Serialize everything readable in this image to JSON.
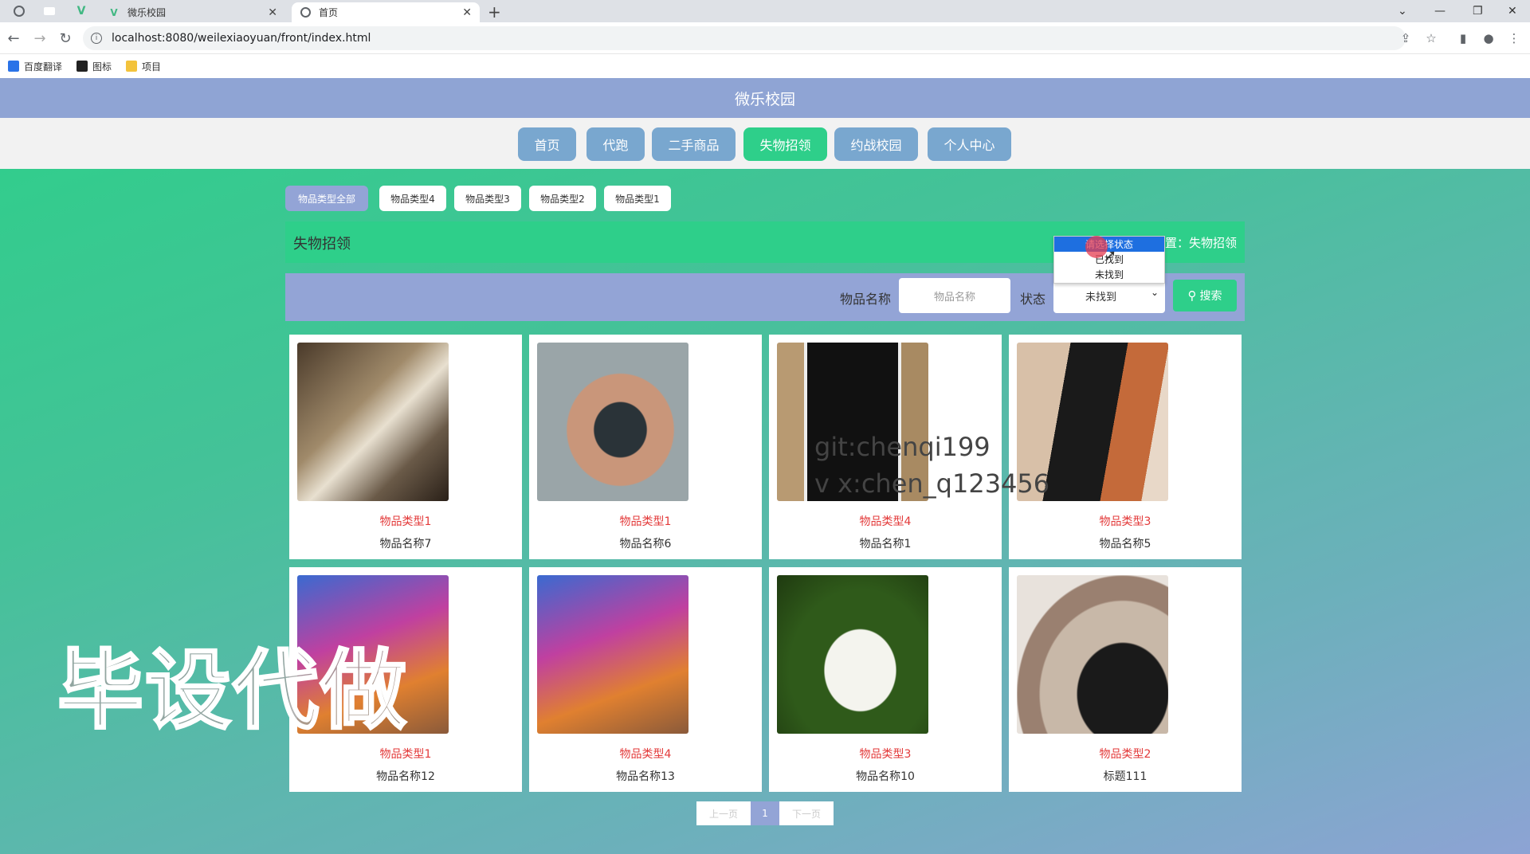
{
  "browser": {
    "tabs": [
      {
        "title": "微乐校园",
        "close": "✕"
      },
      {
        "title": "首页",
        "close": "✕"
      }
    ],
    "new_tab": "+",
    "url": "localhost:8080/weilexiaoyuan/front/index.html",
    "bookmarks": [
      {
        "label": "百度翻译"
      },
      {
        "label": "图标"
      },
      {
        "label": "项目"
      }
    ]
  },
  "site": {
    "title": "微乐校园",
    "menu": [
      {
        "label": "首页",
        "active": false
      },
      {
        "label": "代跑",
        "active": false
      },
      {
        "label": "二手商品",
        "active": false
      },
      {
        "label": "失物招领",
        "active": true
      },
      {
        "label": "约战校园",
        "active": false
      },
      {
        "label": "个人中心",
        "active": false
      }
    ],
    "categories": [
      {
        "label": "物品类型全部",
        "active": true
      },
      {
        "label": "物品类型4",
        "active": false
      },
      {
        "label": "物品类型3",
        "active": false
      },
      {
        "label": "物品类型2",
        "active": false
      },
      {
        "label": "物品类型1",
        "active": false
      }
    ],
    "section_title": "失物招领",
    "breadcrumb": "您现在的位置：失物招领"
  },
  "search": {
    "name_label": "物品名称",
    "name_placeholder": "物品名称",
    "status_label": "状态",
    "status_value": "未找到",
    "status_options": [
      "请选择状态",
      "已找到",
      "未找到"
    ],
    "highlighted_option": "请选择状态",
    "button": "搜索"
  },
  "cards": [
    {
      "type": "物品类型1",
      "name": "物品名称7",
      "image": "notebook-photo"
    },
    {
      "type": "物品类型1",
      "name": "物品名称6",
      "image": "old-phone-photo"
    },
    {
      "type": "物品类型4",
      "name": "物品名称1",
      "image": "iphone-photo"
    },
    {
      "type": "物品类型3",
      "name": "物品名称5",
      "image": "wallet-photo"
    },
    {
      "type": "物品类型1",
      "name": "物品名称12",
      "image": "smartphone-photo"
    },
    {
      "type": "物品类型4",
      "name": "物品名称13",
      "image": "smartphone-photo"
    },
    {
      "type": "物品类型3",
      "name": "物品名称10",
      "image": "book-grass-photo"
    },
    {
      "type": "物品类型2",
      "name": "标题111",
      "image": "person-photo"
    }
  ],
  "pagination": {
    "prev": "上一页",
    "current": "1",
    "next": "下一页"
  },
  "watermarks": [
    "git:chenqi199",
    "v x:chen_q123456",
    "毕设代做"
  ],
  "colors": {
    "accent": "#2ecf8a",
    "header": "#8fa4d4",
    "menu_button": "#79a7cf",
    "type_text": "#e33a3a"
  }
}
